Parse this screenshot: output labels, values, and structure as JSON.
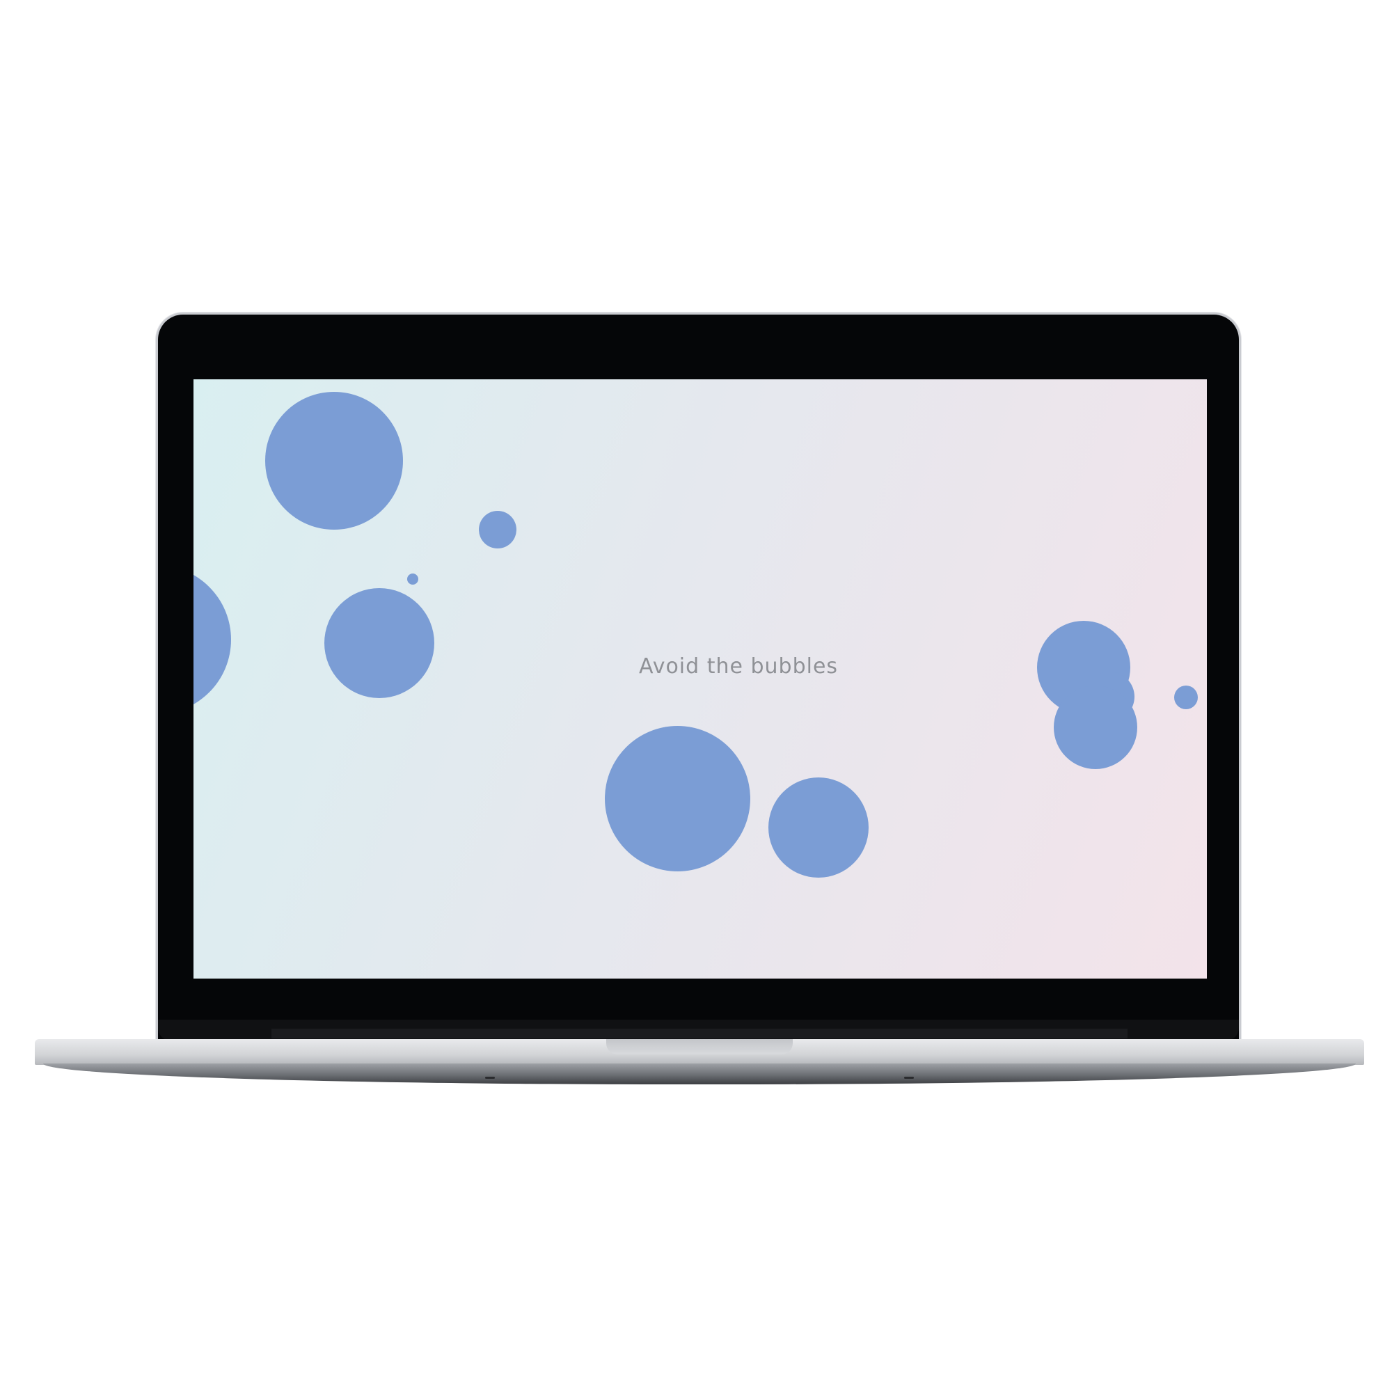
{
  "screen": {
    "tagline": "Avoid the bubbles",
    "bubble_color": "#7b9dd5",
    "background_colors": [
      "#d9eff1",
      "#e5e8ee",
      "#f3e3ea"
    ]
  },
  "device": {
    "type": "laptop",
    "bezel_color": "#050608",
    "body_color": "#d2d4d7"
  }
}
